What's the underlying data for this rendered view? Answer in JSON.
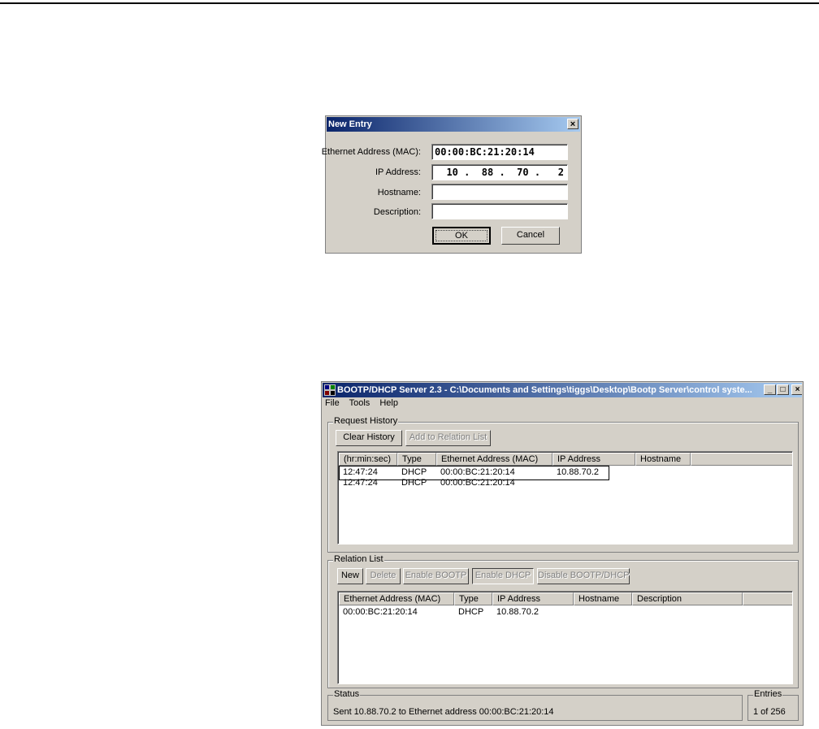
{
  "dialog": {
    "title": "New Entry",
    "close_glyph": "×",
    "mac_label": "Ethernet Address (MAC):",
    "mac_value": "00:00:BC:21:20:14",
    "ip_label": "IP Address:",
    "ip_value": "  10 .  88 .  70 .   2",
    "hostname_label": "Hostname:",
    "hostname_value": "",
    "description_label": "Description:",
    "description_value": "",
    "ok_label": "OK",
    "cancel_label": "Cancel"
  },
  "window": {
    "title": "BOOTP/DHCP Server 2.3 - C:\\Documents and Settings\\tiggs\\Desktop\\Bootp Server\\control syste...",
    "minimize_glyph": "_",
    "maximize_glyph": "□",
    "close_glyph": "×",
    "menu": [
      "File",
      "Tools",
      "Help"
    ]
  },
  "request_history": {
    "legend": "Request History",
    "clear_button": "Clear History",
    "add_button": "Add to Relation List",
    "columns": [
      "(hr:min:sec)",
      "Type",
      "Ethernet Address (MAC)",
      "IP Address",
      "Hostname"
    ],
    "rows": [
      [
        "12:47:24",
        "DHCP",
        "00:00:BC:21:20:14",
        "10.88.70.2",
        ""
      ],
      [
        "12:47:24",
        "DHCP",
        "00:00:BC:21:20:14",
        "",
        ""
      ]
    ]
  },
  "relation_list": {
    "legend": "Relation List",
    "buttons": [
      "New",
      "Delete",
      "Enable BOOTP",
      "Enable DHCP",
      "Disable BOOTP/DHCP"
    ],
    "columns": [
      "Ethernet Address (MAC)",
      "Type",
      "IP Address",
      "Hostname",
      "Description"
    ],
    "rows": [
      [
        "00:00:BC:21:20:14",
        "DHCP",
        "10.88.70.2",
        "",
        ""
      ]
    ]
  },
  "status": {
    "legend": "Status",
    "text": "Sent 10.88.70.2 to Ethernet address 00:00:BC:21:20:14",
    "entries_legend": "Entries",
    "entries_text": "1 of 256"
  }
}
